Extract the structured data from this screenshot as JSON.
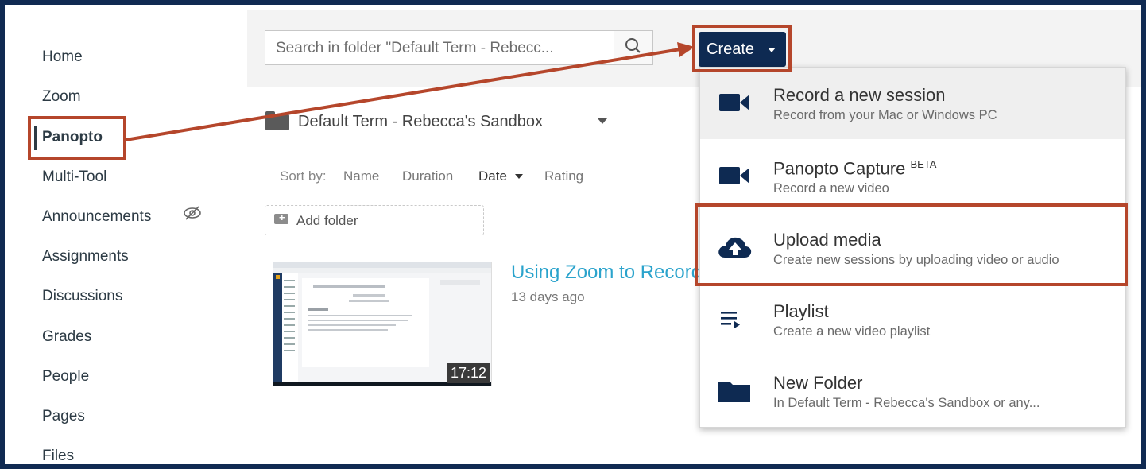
{
  "nav": {
    "items": [
      "Home",
      "Zoom",
      "Panopto",
      "Multi-Tool",
      "Announcements",
      "Assignments",
      "Discussions",
      "Grades",
      "People",
      "Pages",
      "Files"
    ],
    "active": "Panopto"
  },
  "header": {
    "search_placeholder": "Search in folder \"Default Term - Rebecc...",
    "create_label": "Create"
  },
  "folder": {
    "title": "Default Term - Rebecca's Sandbox",
    "sort_label": "Sort by:",
    "sort_options": [
      "Name",
      "Duration",
      "Date",
      "Rating"
    ],
    "sort_active": "Date",
    "add_folder_label": "Add folder"
  },
  "session": {
    "title": "Using Zoom to Record",
    "age": "13 days ago",
    "duration": "17:12"
  },
  "menu": {
    "items": [
      {
        "title": "Record a new session",
        "sup": "",
        "subtitle": "Record from your Mac or Windows PC",
        "icon": "video-camera-icon"
      },
      {
        "title": "Panopto Capture",
        "sup": "BETA",
        "subtitle": "Record a new video",
        "icon": "video-camera-icon"
      },
      {
        "title": "Upload media",
        "sup": "",
        "subtitle": "Create new sessions by uploading video or audio",
        "icon": "cloud-upload-icon"
      },
      {
        "title": "Playlist",
        "sup": "",
        "subtitle": "Create a new video playlist",
        "icon": "playlist-icon"
      },
      {
        "title": "New Folder",
        "sup": "",
        "subtitle": "In Default Term - Rebecca's Sandbox or any...",
        "icon": "folder-icon"
      }
    ]
  },
  "colors": {
    "frame": "#102a52",
    "create_button": "#0e2a52",
    "icon_navy": "#0e2a52",
    "callout": "#b5462b",
    "link": "#2aa3cc"
  }
}
